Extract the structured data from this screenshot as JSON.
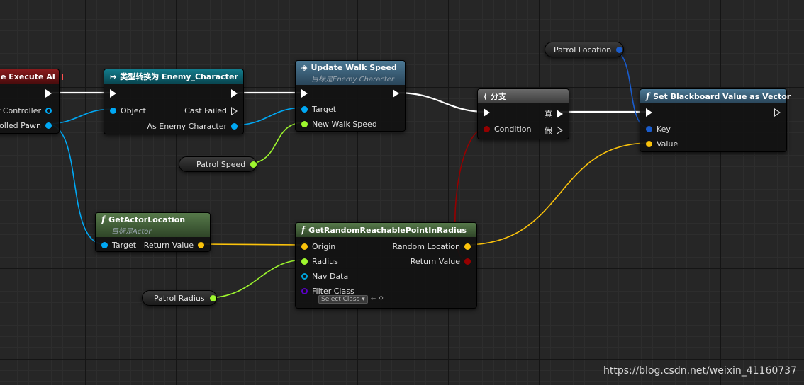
{
  "nodes": {
    "event": {
      "title": "e Execute AI",
      "pin_controller": "er Controller",
      "pin_pawn": "rolled Pawn"
    },
    "cast": {
      "title": "类型转换为 Enemy_Character",
      "pin_object": "Object",
      "pin_cast_failed": "Cast Failed",
      "pin_as_enemy": "As Enemy Character"
    },
    "update_walk": {
      "title": "Update Walk Speed",
      "subtitle": "目标是Enemy Character",
      "pin_target": "Target",
      "pin_new_speed": "New Walk Speed"
    },
    "branch": {
      "title": "分支",
      "pin_condition": "Condition",
      "pin_true": "真",
      "pin_false": "假"
    },
    "set_bb": {
      "title": "Set Blackboard Value as Vector",
      "pin_key": "Key",
      "pin_value": "Value"
    },
    "get_loc": {
      "title": "GetActorLocation",
      "subtitle": "目标是Actor",
      "pin_target": "Target",
      "pin_return": "Return Value"
    },
    "random_point": {
      "title": "GetRandomReachablePointInRadius",
      "pin_origin": "Origin",
      "pin_radius": "Radius",
      "pin_nav": "Nav Data",
      "pin_filter": "Filter Class",
      "select_class": "Select Class",
      "pin_random_loc": "Random Location",
      "pin_return": "Return Value"
    }
  },
  "vars": {
    "patrol_location": "Patrol Location",
    "patrol_speed": "Patrol Speed",
    "patrol_radius": "Patrol Radius"
  },
  "colors": {
    "object_pin": "#00a8f4",
    "float_pin": "#9ef72e",
    "vector_pin": "#fbc30b",
    "bool_pin": "#950000",
    "key_pin": "#1a5ccc",
    "nav_pin": "#00a2d9",
    "class_pin": "#5b00c7",
    "header_event": "#7b1416",
    "header_cast": "#0c5a6a",
    "header_function": "#3e6680",
    "header_pure": "#4a6d3e",
    "header_branch": "#5b5b5b"
  },
  "icons": {
    "cast": "cast-arrow-icon",
    "function": "function-icon",
    "branch": "branch-icon",
    "update": "diamond-icon"
  },
  "watermark": "https://blog.csdn.net/weixin_41160737"
}
